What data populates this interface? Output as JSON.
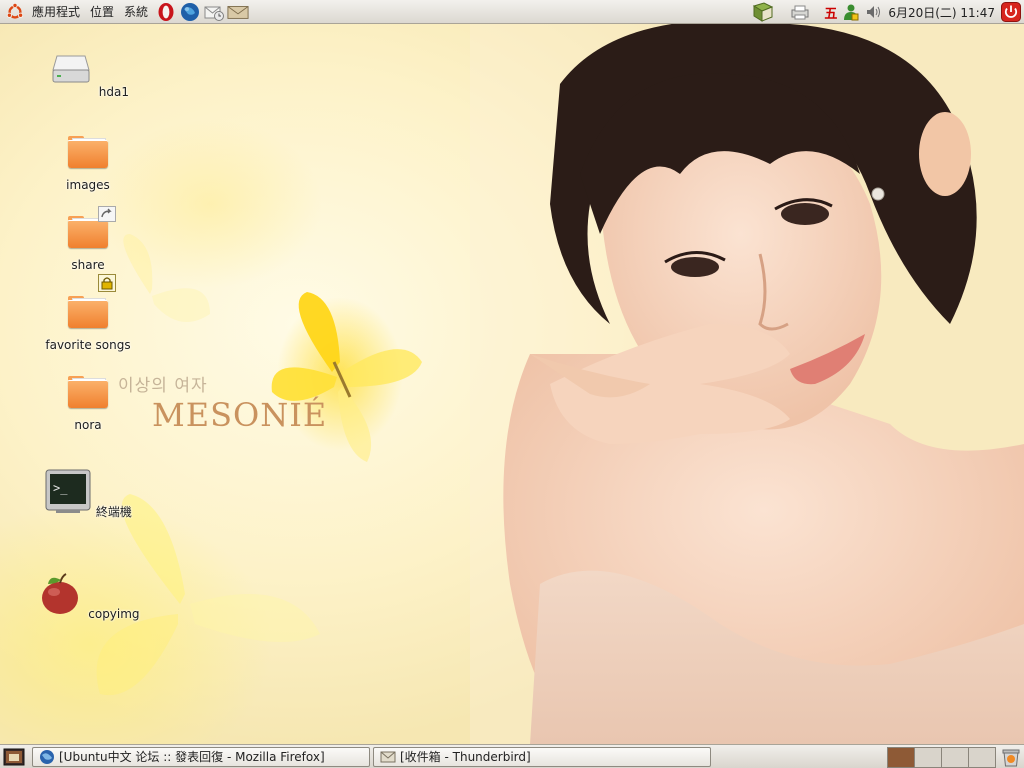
{
  "top_panel": {
    "menus": [
      "應用程式",
      "位置",
      "系統"
    ],
    "launchers": [
      "opera-icon",
      "browser-globe-icon",
      "email-send-icon",
      "mail-envelope-icon"
    ],
    "tray": {
      "notes_icon": "notebook-icon",
      "printer_icon": "printer-icon",
      "ime_label": "五",
      "network_icon": "user-status-icon",
      "volume_icon": "speaker-icon",
      "clock": "6月20日(二) 11:47"
    }
  },
  "desktop": {
    "icons": [
      {
        "label": "hda1",
        "icon": "drive-icon"
      },
      {
        "label": "images",
        "icon": "folder-icon"
      },
      {
        "label": "share",
        "icon": "folder-link-icon"
      },
      {
        "label": "favorite songs",
        "icon": "folder-locked-icon"
      },
      {
        "label": "nora",
        "icon": "folder-icon"
      },
      {
        "label": "終端機",
        "icon": "terminal-icon"
      },
      {
        "label": "copyimg",
        "icon": "apple-icon"
      }
    ],
    "wallpaper": {
      "korean_text": "이상의 여자",
      "brand_text": "MESONIÉ"
    }
  },
  "bottom_panel": {
    "tasks": [
      {
        "label": "[Ubuntu中文 论坛 :: 發表回復 - Mozilla Firefox]",
        "icon": "firefox-icon"
      },
      {
        "label": "[收件箱 - Thunderbird]",
        "icon": "thunderbird-icon"
      }
    ],
    "workspaces": 4,
    "active_workspace": 1
  },
  "colors": {
    "panel": "#dcd8d1",
    "folder_orange": "#f0802e",
    "active_workspace": "#8e5a36",
    "power_red": "#d7261e"
  }
}
